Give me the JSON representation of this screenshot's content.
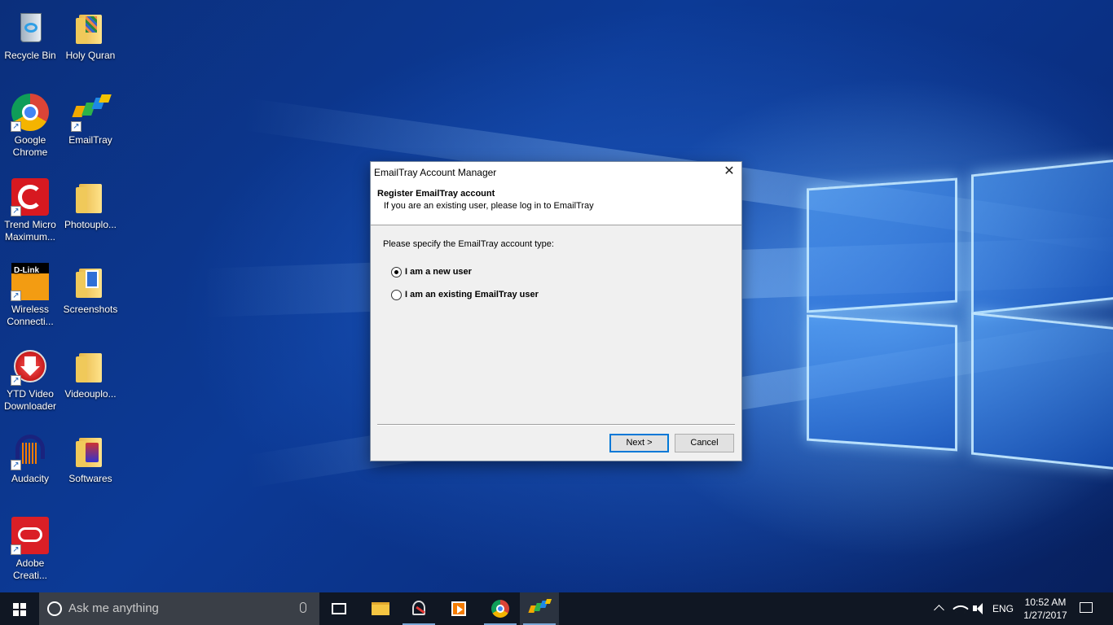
{
  "desktop": {
    "icons": [
      {
        "name": "recycle-bin",
        "label": "Recycle Bin"
      },
      {
        "name": "holy-quran",
        "label": "Holy Quran"
      },
      {
        "name": "google-chrome",
        "label": "Google Chrome"
      },
      {
        "name": "emailtray",
        "label": "EmailTray"
      },
      {
        "name": "trend-micro",
        "label": "Trend Micro Maximum..."
      },
      {
        "name": "photouplo",
        "label": "Photouplo..."
      },
      {
        "name": "wireless-connection",
        "label": "Wireless Connecti..."
      },
      {
        "name": "screenshots",
        "label": "Screenshots"
      },
      {
        "name": "ytd-video-downloader",
        "label": "YTD Video Downloader"
      },
      {
        "name": "videouplo",
        "label": "Videouplo..."
      },
      {
        "name": "audacity",
        "label": "Audacity"
      },
      {
        "name": "softwares",
        "label": "Softwares"
      },
      {
        "name": "adobe-creative",
        "label": "Adobe Creati..."
      }
    ]
  },
  "dialog": {
    "title": "EmailTray Account Manager",
    "close_glyph": "✕",
    "heading": "Register EmailTray account",
    "subheading": "If you are an existing user, please log in to EmailTray",
    "prompt": "Please specify the EmailTray account type:",
    "options": [
      {
        "label": "I am a new user",
        "checked": true
      },
      {
        "label": "I am an existing EmailTray user",
        "checked": false
      }
    ],
    "next_label": "Next >",
    "cancel_label": "Cancel",
    "accent": "#0078d7"
  },
  "taskbar": {
    "search_placeholder": "Ask me anything",
    "language": "ENG",
    "time": "10:52 AM",
    "date": "1/27/2017"
  }
}
